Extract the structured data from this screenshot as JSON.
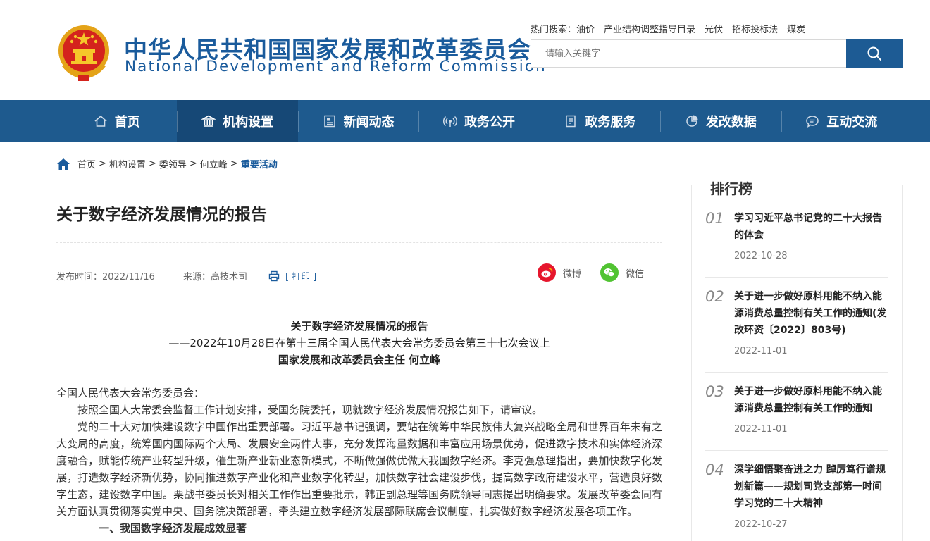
{
  "header": {
    "title_cn": "中华人民共和国国家发展和改革委员会",
    "title_en": "National Development and Reform Commission",
    "hot_label": "热门搜索：",
    "hot_words": [
      "油价",
      "产业结构调整指导目录",
      "光伏",
      "招标投标法",
      "煤炭"
    ],
    "search_placeholder": "请输入关键字"
  },
  "nav": [
    {
      "label": "首页",
      "icon": "home-icon"
    },
    {
      "label": "机构设置",
      "icon": "institution-icon"
    },
    {
      "label": "新闻动态",
      "icon": "news-icon"
    },
    {
      "label": "政务公开",
      "icon": "broadcast-icon"
    },
    {
      "label": "政务服务",
      "icon": "document-icon"
    },
    {
      "label": "发改数据",
      "icon": "pie-chart-icon"
    },
    {
      "label": "互动交流",
      "icon": "chat-icon"
    }
  ],
  "breadcrumb": [
    "首页",
    "机构设置",
    "委领导",
    "何立峰",
    "重要活动"
  ],
  "article": {
    "title": "关于数字经济发展情况的报告",
    "publish_label": "发布时间：2022/11/16",
    "source_label": "来源：高技术司",
    "print_label": "[ 打印 ]",
    "share_weibo": "微博",
    "share_wechat": "微信",
    "heading": "关于数字经济发展情况的报告",
    "subheading": "——2022年10月28日在第十三届全国人民代表大会常务委员会第三十七次会议上",
    "speaker": "国家发展和改革委员会主任  何立峰",
    "salutation": "全国人民代表大会常务委员会：",
    "para1": "按照全国人大常委会监督工作计划安排，受国务院委托，现就数字经济发展情况报告如下，请审议。",
    "para2": "党的二十大对加快建设数字中国作出重要部署。习近平总书记强调，要站在统筹中华民族伟大复兴战略全局和世界百年未有之大变局的高度，统筹国内国际两个大局、发展安全两件大事，充分发挥海量数据和丰富应用场景优势，促进数字技术和实体经济深度融合，赋能传统产业转型升级，催生新产业新业态新模式，不断做强做优做大我国数字经济。李克强总理指出，要加快数字化发展，打造数字经济新优势，协同推进数字产业化和产业数字化转型，加快数字社会建设步伐，提高数字政府建设水平，营造良好数字生态，建设数字中国。栗战书委员长对相关工作作出重要批示，韩正副总理等国务院领导同志提出明确要求。发展改革委会同有关方面认真贯彻落实党中央、国务院决策部署，牵头建立数字经济发展部际联席会议制度，扎实做好数字经济发展各项工作。",
    "para3": "一、我国数字经济发展成效显著"
  },
  "rank": {
    "title": "排行榜",
    "items": [
      {
        "num": "01",
        "text": "学习习近平总书记党的二十大报告的体会",
        "date": "2022-10-28"
      },
      {
        "num": "02",
        "text": "关于进一步做好原料用能不纳入能源消费总量控制有关工作的通知(发改环资〔2022〕803号)",
        "date": "2022-11-01"
      },
      {
        "num": "03",
        "text": "关于进一步做好原料用能不纳入能源消费总量控制有关工作的通知",
        "date": "2022-11-01"
      },
      {
        "num": "04",
        "text": "深学细悟聚奋进之力 踔厉笃行谱规划新篇——规划司党支部第一时间学习党的二十大精神",
        "date": "2022-10-27"
      }
    ]
  },
  "colors": {
    "brand_blue": "#1a5b9c",
    "nav_bg": "#1e5a8e",
    "nav_active": "#164876",
    "weibo": "#e6162d",
    "wechat": "#51c332"
  }
}
